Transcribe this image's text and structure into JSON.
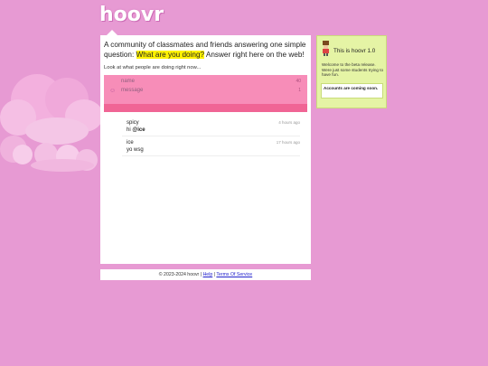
{
  "brand": {
    "logo_text": "hoovr"
  },
  "main": {
    "intro_before": "A community of classmates and friends answering one simple question: ",
    "intro_highlight": "What are you doing?",
    "intro_after": " Answer right here on the web!",
    "look_text": "Look at what people are doing right now..."
  },
  "form": {
    "name_placeholder": "name",
    "name_counter": "40",
    "message_placeholder": "message",
    "message_counter": "1"
  },
  "messages": [
    {
      "author": "spicy",
      "text_prefix": "hi ",
      "mention": "@ice",
      "time": "4 hours ago"
    },
    {
      "author": "ice",
      "text_prefix": "yo wsg",
      "mention": "",
      "time": "17 hours ago"
    }
  ],
  "sidebar": {
    "title": "This is hoovr 1.0",
    "description": "Welcome to the beta release. Were just some students trying to have fun.",
    "note": "Accounts are coming soon."
  },
  "footer": {
    "copyright": "© 2023-2024 hoovr",
    "help_label": "Help",
    "terms_label": "Terms Of Service",
    "separator": "|"
  },
  "colors": {
    "background": "#e79ad3",
    "form_pink": "#f78db8",
    "bar_pink": "#f06595",
    "sidebar_green": "#e5f4a5",
    "highlight": "#fff200"
  }
}
